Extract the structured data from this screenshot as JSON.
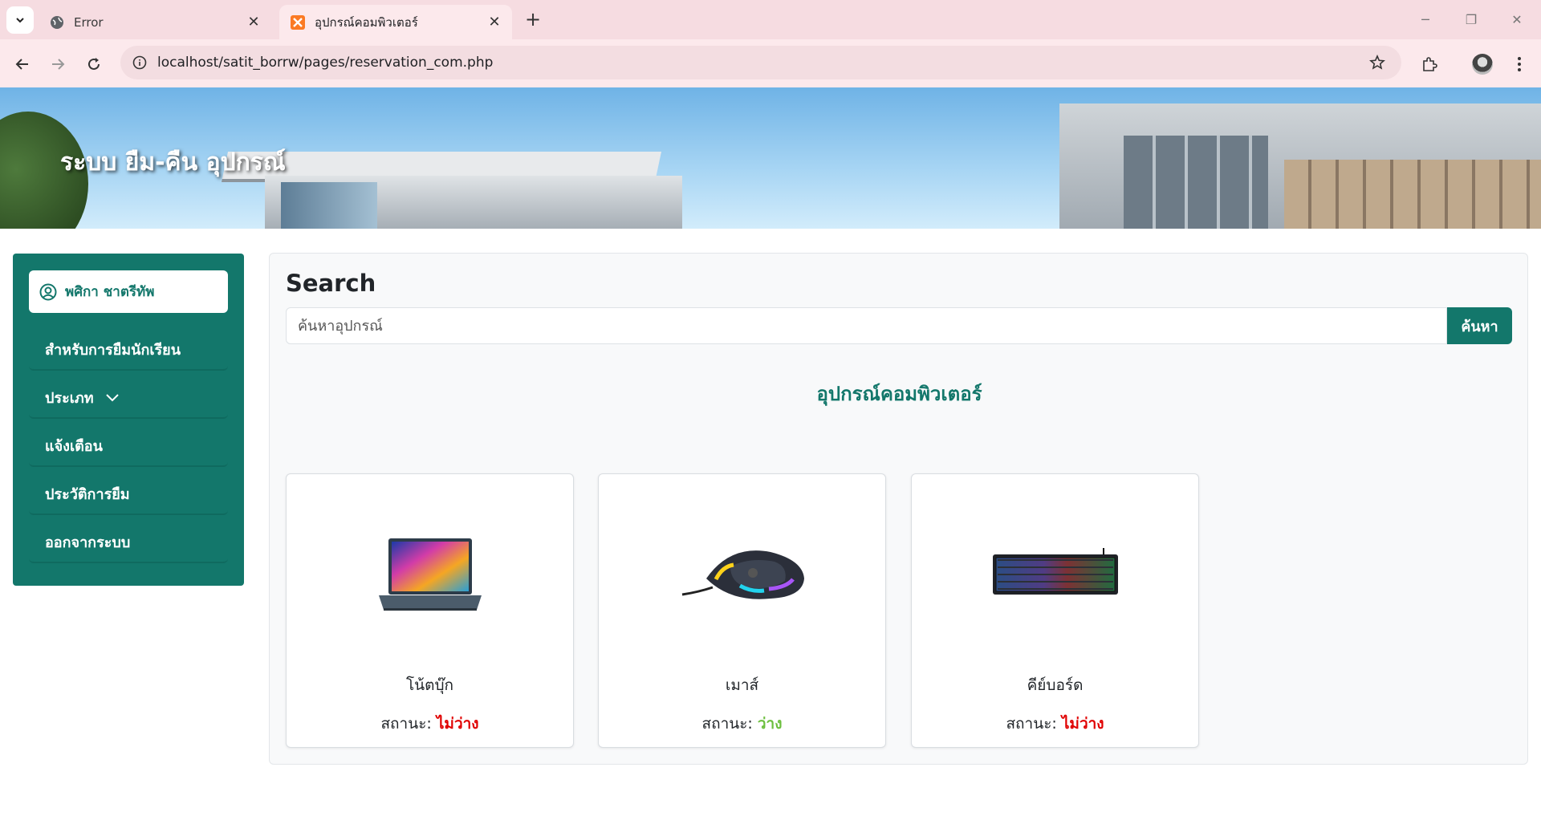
{
  "browser": {
    "tabs": [
      {
        "title": "Error",
        "active": false
      },
      {
        "title": "อุปกรณ์คอมพิวเตอร์",
        "active": true
      }
    ],
    "url": "localhost/satit_borrw/pages/reservation_com.php"
  },
  "banner": {
    "title": "ระบบ ยืม-คืน อุปกรณ์"
  },
  "sidebar": {
    "user_name": "พศิกา ชาตรีทัพ",
    "items": [
      {
        "label": "สำหรับการยืมนักเรียน"
      },
      {
        "label": "ประเภท"
      },
      {
        "label": "แจ้งเตือน"
      },
      {
        "label": "ประวัติการยืม"
      },
      {
        "label": "ออกจากระบบ"
      }
    ]
  },
  "main": {
    "search_title": "Search",
    "search_placeholder": "ค้นหาอุปกรณ์",
    "search_button": "ค้นหา",
    "section_title": "อุปกรณ์คอมพิวเตอร์",
    "status_label": "สถานะ:",
    "items": [
      {
        "name": "โน้ตบุ๊ก",
        "status": "ไม่ว่าง",
        "icon": "laptop-image"
      },
      {
        "name": "เมาส์",
        "status": "ว่าง",
        "icon": "mouse-image"
      },
      {
        "name": "คีย์บอร์ด",
        "status": "ไม่ว่าง",
        "icon": "keyboard-image"
      }
    ]
  },
  "colors": {
    "primary": "#13776b",
    "status_unavailable": "#e00000",
    "status_available": "#6cbf3e"
  }
}
